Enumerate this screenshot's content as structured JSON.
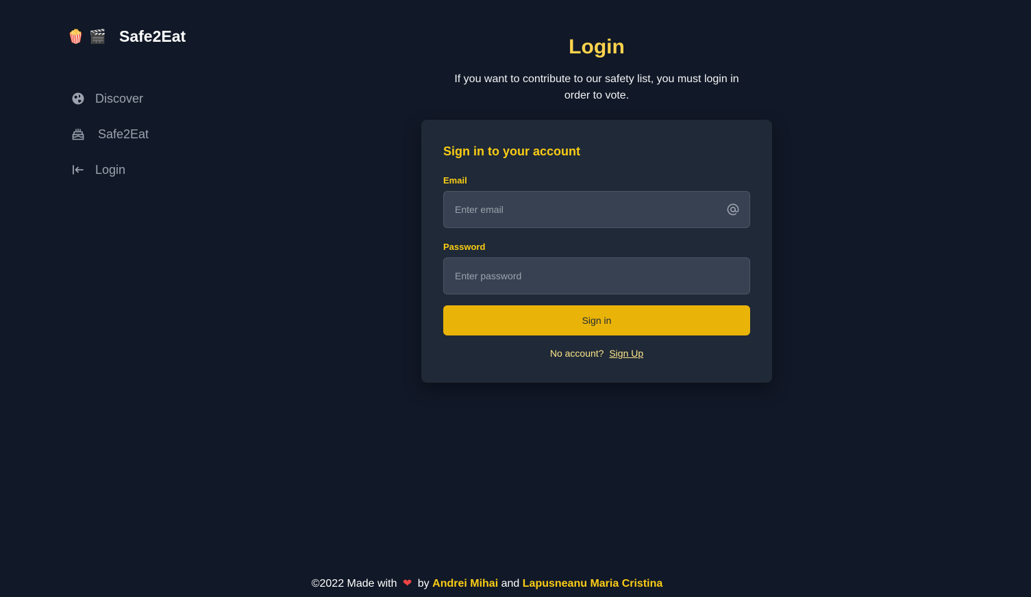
{
  "brand": {
    "emoji_1": "🍿",
    "emoji_2": "🎬",
    "name": "Safe2Eat"
  },
  "sidebar": {
    "items": [
      {
        "label": "Discover",
        "icon": "globe-icon"
      },
      {
        "label": "Safe2Eat",
        "icon": "cake-icon"
      },
      {
        "label": "Login",
        "icon": "login-arrow-icon"
      }
    ]
  },
  "main": {
    "title": "Login",
    "intro": "If you want to contribute to our safety list, you must login in order to vote."
  },
  "form": {
    "heading": "Sign in to your account",
    "email_label": "Email",
    "email_placeholder": "Enter email",
    "password_label": "Password",
    "password_placeholder": "Enter password",
    "submit_label": "Sign in",
    "no_account_text": "No account?",
    "signup_link": "Sign Up"
  },
  "footer": {
    "prefix": "©2022 Made with",
    "heart": "❤",
    "by": "by",
    "author_1": "Andrei Mihai",
    "and": "and",
    "author_2": "Lapusneanu Maria Cristina"
  },
  "colors": {
    "background": "#111827",
    "card": "#1f2937",
    "accent": "#facc15",
    "button": "#eab308"
  }
}
